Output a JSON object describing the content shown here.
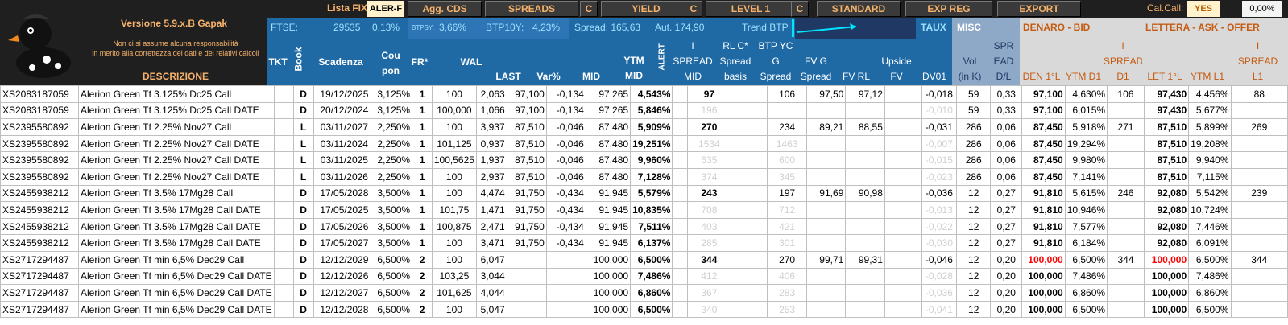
{
  "app": {
    "version": "Versione 5.9.x.B Gapak",
    "disclaimer_line1": "Non ci si assume alcuna responsabilità",
    "disclaimer_line2": "in merito alla correttezza dei dati e dei relativi calcoli",
    "descrizione": "DESCRIZIONE"
  },
  "toolbar": {
    "lista_label": "Lista FIX:",
    "lista_value": "ALER-F",
    "agg_cds": "Agg. CDS",
    "spreads": "SPREADS",
    "c1": "C",
    "yield": "YIELD",
    "c2": "C",
    "level1": "LEVEL 1",
    "c3": "C",
    "standard": "STANDARD",
    "exp_reg": "EXP REG",
    "export": "EXPORT",
    "calcall_label": "Cal.Call:",
    "calcall_value": "YES",
    "pct_value": "0,00%"
  },
  "market": {
    "ftse_label": "FTSE:",
    "ftse_value": "29535",
    "ftse_pct": "0,13%",
    "btpsy_label": "BTPSY:",
    "btpsy_value": "3,66%",
    "btp10y_label": "BTP10Y:",
    "btp10y_value": "4,23%",
    "spread_label": "Spread: 165,63",
    "aut_label": "Aut. 174,90",
    "trend_label": "Trend BTP",
    "taux": "TAUX",
    "misc": "MISC",
    "denaro": "DENARO - BID",
    "lettera": "LETTERA - ASK - OFFER"
  },
  "headers": {
    "tkt": "TKT",
    "book": "Book",
    "scadenza": "Scadenza",
    "coupon1": "Cou",
    "coupon2": "pon",
    "fr": "FR*",
    "wal": "WAL",
    "last": "LAST",
    "var": "Var%",
    "mid": "MID",
    "ytm1": "YTM",
    "ytm2": "MID",
    "alert": "ALERT",
    "spread_i": "I",
    "spread1": "SPREAD",
    "spread2": "MID",
    "rlc1": "RL C*",
    "rlc2": "Spread",
    "rlc3": "basis",
    "btpyc1": "BTP YC",
    "btpyc2": "G",
    "btpyc3": "Spread",
    "fvg1": "FV G",
    "fvg2": "Spread",
    "fvrl": "FV RL",
    "upside1": "Upside",
    "upside2": "FV",
    "dv01": "DV01",
    "vol1": "Vol",
    "vol2": "(in K)",
    "spr1": "SPR",
    "spr2": "EAD",
    "spr3": "D/L",
    "den1": "DEN 1°L",
    "ytmd1": "YTM D1",
    "sd_i": "I",
    "sd1": "SPREAD",
    "sd2": "D1",
    "let1": "LET 1°L",
    "ytml1": "YTM L1",
    "sl_i": "I",
    "sl1": "SPREAD",
    "sl2": "L1"
  },
  "rows": [
    [
      "XS2083187059",
      "Alerion Green Tf 3.125% Dc25 Call",
      "",
      "D",
      "19/12/2025",
      "3,125%",
      "1",
      "100",
      "2,063",
      "97,100",
      "-0,134",
      "97,265",
      "4,543%",
      "",
      "97",
      "",
      "106",
      "97,50",
      "97,12",
      "",
      "-0,018",
      "59",
      "0,33",
      "97,100",
      "4,630%",
      "106",
      "97,430",
      "4,456%",
      "88"
    ],
    [
      "XS2083187059",
      "Alerion Green Tf 3.125% Dc25 Call DATE",
      "",
      "D",
      "20/12/2024",
      "3,125%",
      "1",
      "100,000",
      "1,066",
      "97,100",
      "-0,134",
      "97,265",
      "5,846%",
      "",
      "196",
      "",
      "",
      "",
      "",
      "",
      "-0,010",
      "59",
      "0,33",
      "97,100",
      "6,015%",
      "",
      "97,430",
      "5,677%",
      ""
    ],
    [
      "XS2395580892",
      "Alerion Green Tf  2.25% Nov27 Call",
      "",
      "L",
      "03/11/2027",
      "2,250%",
      "1",
      "100",
      "3,937",
      "87,510",
      "-0,046",
      "87,480",
      "5,909%",
      "",
      "270",
      "",
      "234",
      "89,21",
      "88,55",
      "",
      "-0,031",
      "286",
      "0,06",
      "87,450",
      "5,918%",
      "271",
      "87,510",
      "5,899%",
      "269"
    ],
    [
      "XS2395580892",
      "Alerion Green Tf  2.25% Nov27 Call DATE",
      "",
      "L",
      "03/11/2024",
      "2,250%",
      "1",
      "101,125",
      "0,937",
      "87,510",
      "-0,046",
      "87,480",
      "19,251%",
      "",
      "1534",
      "",
      "1463",
      "",
      "",
      "",
      "-0,007",
      "286",
      "0,06",
      "87,450",
      "19,294%",
      "",
      "87,510",
      "19,208%",
      ""
    ],
    [
      "XS2395580892",
      "Alerion Green Tf  2.25% Nov27 Call DATE",
      "",
      "L",
      "03/11/2025",
      "2,250%",
      "1",
      "100,5625",
      "1,937",
      "87,510",
      "-0,046",
      "87,480",
      "9,960%",
      "",
      "635",
      "",
      "600",
      "",
      "",
      "",
      "-0,015",
      "286",
      "0,06",
      "87,450",
      "9,980%",
      "",
      "87,510",
      "9,940%",
      ""
    ],
    [
      "XS2395580892",
      "Alerion Green Tf  2.25% Nov27 Call DATE",
      "",
      "L",
      "03/11/2026",
      "2,250%",
      "1",
      "100",
      "2,937",
      "87,510",
      "-0,046",
      "87,480",
      "7,128%",
      "",
      "374",
      "",
      "345",
      "",
      "",
      "",
      "-0,023",
      "286",
      "0,06",
      "87,450",
      "7,141%",
      "",
      "87,510",
      "7,115%",
      ""
    ],
    [
      "XS2455938212",
      "Alerion Green Tf  3.5% 17Mg28 Call",
      "",
      "D",
      "17/05/2028",
      "3,500%",
      "1",
      "100",
      "4,474",
      "91,750",
      "-0,434",
      "91,945",
      "5,579%",
      "",
      "243",
      "",
      "197",
      "91,69",
      "90,98",
      "",
      "-0,036",
      "12",
      "0,27",
      "91,810",
      "5,615%",
      "246",
      "92,080",
      "5,542%",
      "239"
    ],
    [
      "XS2455938212",
      "Alerion Green Tf  3.5% 17Mg28 Call DATE",
      "",
      "D",
      "17/05/2025",
      "3,500%",
      "1",
      "101,75",
      "1,471",
      "91,750",
      "-0,434",
      "91,945",
      "10,835%",
      "",
      "708",
      "",
      "712",
      "",
      "",
      "",
      "-0,013",
      "12",
      "0,27",
      "91,810",
      "10,946%",
      "",
      "92,080",
      "10,724%",
      ""
    ],
    [
      "XS2455938212",
      "Alerion Green Tf  3.5% 17Mg28 Call DATE",
      "",
      "D",
      "17/05/2026",
      "3,500%",
      "1",
      "100,875",
      "2,471",
      "91,750",
      "-0,434",
      "91,945",
      "7,511%",
      "",
      "403",
      "",
      "421",
      "",
      "",
      "",
      "-0,022",
      "12",
      "0,27",
      "91,810",
      "7,577%",
      "",
      "92,080",
      "7,446%",
      ""
    ],
    [
      "XS2455938212",
      "Alerion Green Tf  3.5% 17Mg28 Call DATE",
      "",
      "D",
      "17/05/2027",
      "3,500%",
      "1",
      "100",
      "3,471",
      "91,750",
      "-0,434",
      "91,945",
      "6,137%",
      "",
      "285",
      "",
      "301",
      "",
      "",
      "",
      "-0,030",
      "12",
      "0,27",
      "91,810",
      "6,184%",
      "",
      "92,080",
      "6,091%",
      ""
    ],
    [
      "XS2717294487",
      "Alerion Green Tf min 6,5% Dec29 Call",
      "",
      "D",
      "12/12/2029",
      "6,500%",
      "2",
      "100",
      "6,047",
      "",
      "",
      "100,000",
      "6,500%",
      "",
      "344",
      "",
      "270",
      "99,71",
      "99,31",
      "",
      "-0,046",
      "12",
      "0,20",
      "100,000",
      "6,500%",
      "344",
      "100,000",
      "6,500%",
      "344"
    ],
    [
      "XS2717294487",
      "Alerion Green Tf min 6,5% Dec29 Call DATE",
      "",
      "D",
      "12/12/2026",
      "6,500%",
      "2",
      "103,25",
      "3,044",
      "",
      "",
      "100,000",
      "7,486%",
      "",
      "412",
      "",
      "406",
      "",
      "",
      "",
      "-0,028",
      "12",
      "0,20",
      "100,000",
      "7,486%",
      "",
      "100,000",
      "7,486%",
      ""
    ],
    [
      "XS2717294487",
      "Alerion Green Tf min 6,5% Dec29 Call DATE",
      "",
      "D",
      "12/12/2027",
      "6,500%",
      "2",
      "101,625",
      "4,044",
      "",
      "",
      "100,000",
      "6,860%",
      "",
      "367",
      "",
      "283",
      "",
      "",
      "",
      "-0,036",
      "12",
      "0,20",
      "100,000",
      "6,860%",
      "",
      "100,000",
      "6,860%",
      ""
    ],
    [
      "XS2717294487",
      "Alerion Green Tf min 6,5% Dec29 Call DATE",
      "",
      "D",
      "12/12/2028",
      "6,500%",
      "2",
      "100",
      "5,047",
      "",
      "",
      "100,000",
      "6,500%",
      "",
      "340",
      "",
      "253",
      "",
      "",
      "",
      "-0,041",
      "12",
      "0,20",
      "100,000",
      "6,500%",
      "",
      "100,000",
      "6,500%",
      ""
    ]
  ],
  "colors": {
    "orange": "#f6b26b",
    "cyan": "#9fe0ff",
    "red": "#ff0000"
  }
}
